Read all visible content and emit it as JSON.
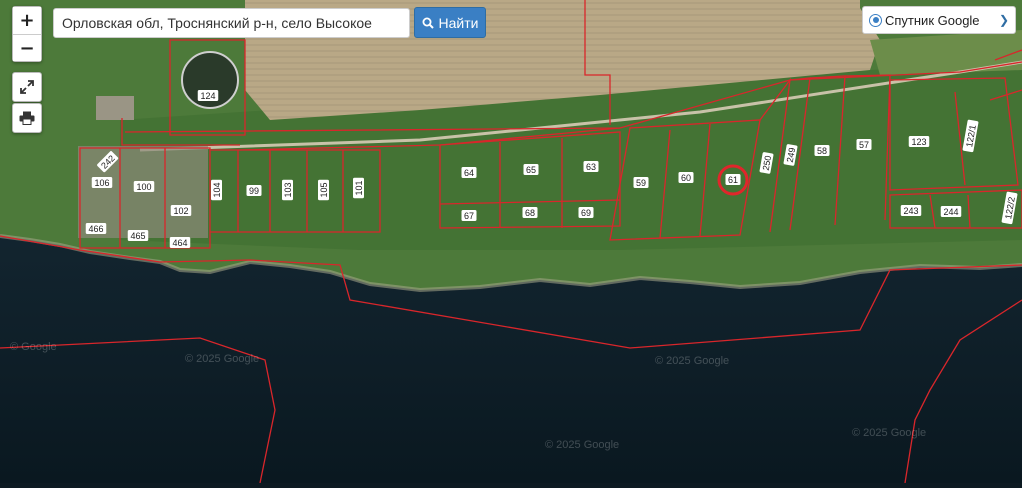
{
  "search": {
    "value": "Орловская обл, Троснянский р-н, село Высокое",
    "button_label": "Найти"
  },
  "layer": {
    "selected": "Спутник Google"
  },
  "controls": {
    "zoom_in": "+",
    "zoom_out": "−"
  },
  "map": {
    "base": "satellite",
    "highlight_parcel": "61",
    "boundary_color": "#d9262b",
    "watermarks": [
      "© 2025 Google",
      "© 2025 Google",
      "© 2025 Google",
      "© 2025 Google",
      "© Google"
    ]
  },
  "parcels": [
    "124",
    "242",
    "106",
    "100",
    "102",
    "466",
    "465",
    "464",
    "104",
    "99",
    "103",
    "105",
    "101",
    "64",
    "65",
    "63",
    "67",
    "68",
    "69",
    "59",
    "60",
    "61",
    "250",
    "249",
    "58",
    "57",
    "123",
    "122/1",
    "243",
    "244",
    "122/2"
  ]
}
